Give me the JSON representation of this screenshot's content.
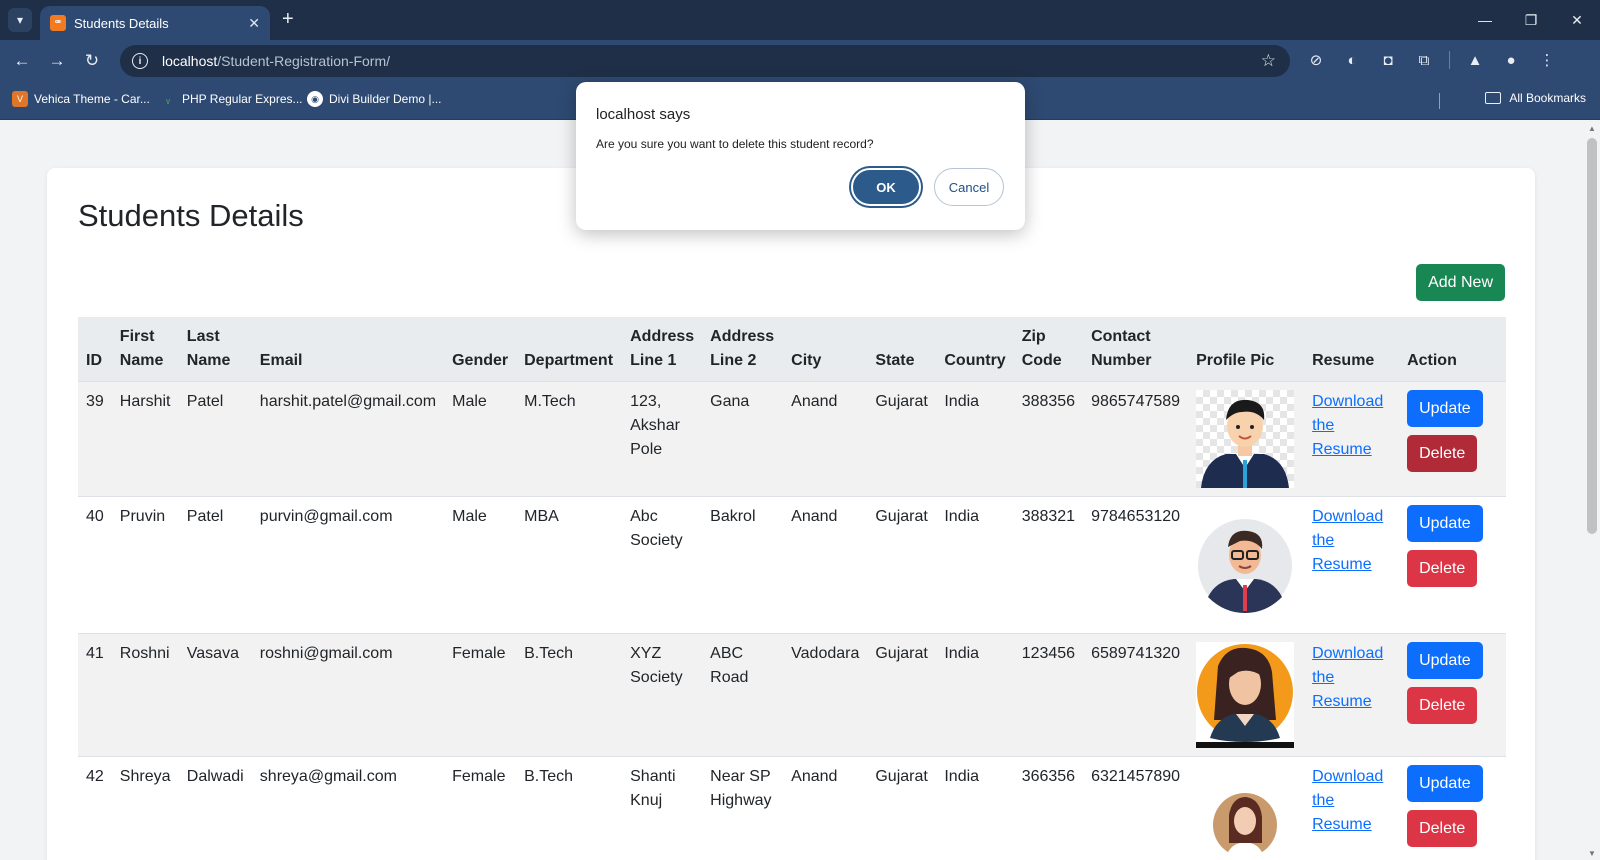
{
  "browser": {
    "tab_title": "Students Details",
    "tab_favicon": "XAMPP",
    "url_host": "localhost",
    "url_path": "/Student-Registration-Form/",
    "bookmarks": [
      {
        "label": "Vehica Theme - Car...",
        "icon": "vehica-icon"
      },
      {
        "label": "PHP Regular Expres...",
        "icon": "php-icon"
      },
      {
        "label": "Divi Builder Demo |...",
        "icon": "globe-icon"
      }
    ],
    "all_bookmarks_label": "All Bookmarks"
  },
  "page": {
    "title": "Students Details",
    "add_new_label": "Add New"
  },
  "table": {
    "headers": {
      "id": "ID",
      "first_name": "First Name",
      "last_name": "Last Name",
      "email": "Email",
      "gender": "Gender",
      "department": "Department",
      "address1": "Address Line 1",
      "address2": "Address Line 2",
      "city": "City",
      "state": "State",
      "country": "Country",
      "zip": "Zip Code",
      "contact": "Contact Number",
      "profile_pic": "Profile Pic",
      "resume": "Resume",
      "action": "Action"
    },
    "rows": [
      {
        "id": "39",
        "first_name": "Harshit",
        "last_name": "Patel",
        "email": "harshit.patel@gmail.com",
        "gender": "Male",
        "department": "M.Tech",
        "address1": "123, Akshar Pole",
        "address2": "Gana",
        "city": "Anand",
        "state": "Gujarat",
        "country": "India",
        "zip": "388356",
        "contact": "9865747589",
        "resume_link": "Download the Resume",
        "update_label": "Update",
        "delete_label": "Delete"
      },
      {
        "id": "40",
        "first_name": "Pruvin",
        "last_name": "Patel",
        "email": "purvin@gmail.com",
        "gender": "Male",
        "department": "MBA",
        "address1": "Abc Society",
        "address2": "Bakrol",
        "city": "Anand",
        "state": "Gujarat",
        "country": "India",
        "zip": "388321",
        "contact": "9784653120",
        "resume_link": "Download the Resume",
        "update_label": "Update",
        "delete_label": "Delete"
      },
      {
        "id": "41",
        "first_name": "Roshni",
        "last_name": "Vasava",
        "email": "roshni@gmail.com",
        "gender": "Female",
        "department": "B.Tech",
        "address1": "XYZ Society",
        "address2": "ABC Road",
        "city": "Vadodara",
        "state": "Gujarat",
        "country": "India",
        "zip": "123456",
        "contact": "6589741320",
        "resume_link": "Download the Resume",
        "update_label": "Update",
        "delete_label": "Delete"
      },
      {
        "id": "42",
        "first_name": "Shreya",
        "last_name": "Dalwadi",
        "email": "shreya@gmail.com",
        "gender": "Female",
        "department": "B.Tech",
        "address1": "Shanti Knuj",
        "address2": "Near SP Highway",
        "city": "Anand",
        "state": "Gujarat",
        "country": "India",
        "zip": "366356",
        "contact": "6321457890",
        "resume_link": "Download the Resume",
        "update_label": "Update",
        "delete_label": "Delete"
      }
    ]
  },
  "dialog": {
    "title": "localhost says",
    "message": "Are you sure you want to delete this student record?",
    "ok_label": "OK",
    "cancel_label": "Cancel"
  },
  "colors": {
    "primary": "#0d6efd",
    "danger": "#dc3545",
    "success": "#198754",
    "browser_chrome": "#2e4a72"
  }
}
